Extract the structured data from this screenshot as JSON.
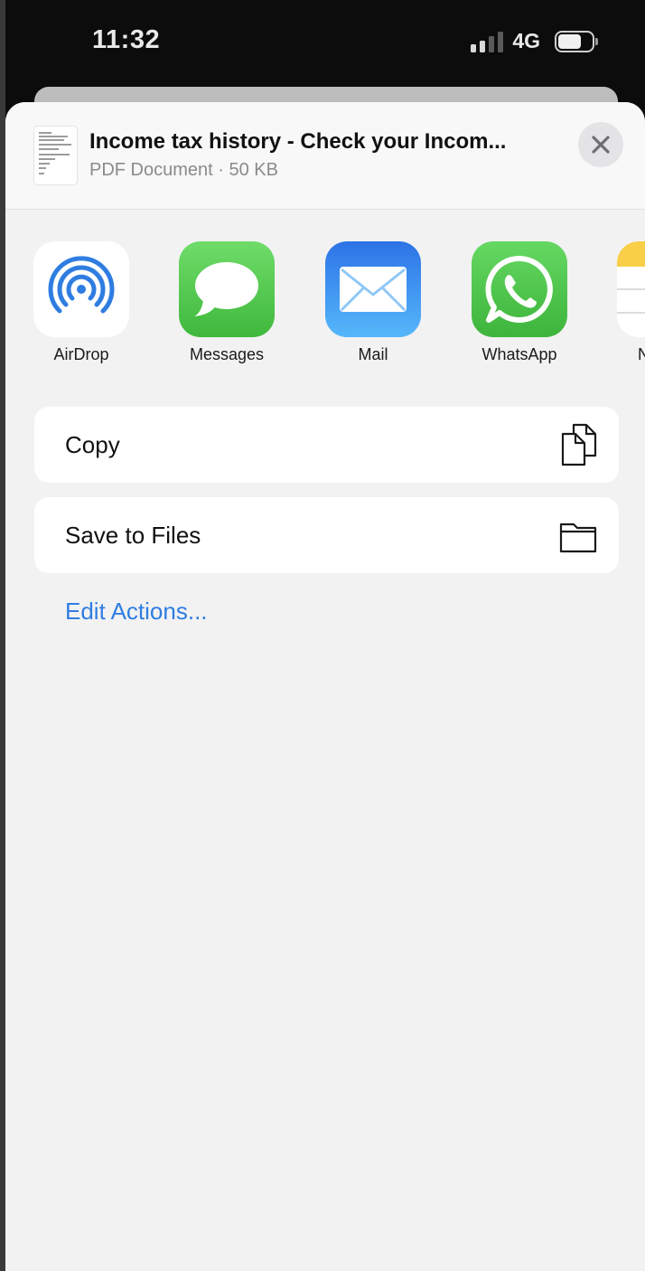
{
  "status_bar": {
    "time": "11:32",
    "network": "4G",
    "signal_bars_active": 2,
    "signal_bars_total": 4,
    "battery_level": 0.6
  },
  "share_sheet": {
    "document": {
      "title": "Income tax history - Check your Incom...",
      "subtitle": "PDF Document · 50 KB",
      "icon": "pdf-thumbnail"
    },
    "close_icon": "close-icon",
    "apps": [
      {
        "label": "AirDrop",
        "icon": "airdrop-icon"
      },
      {
        "label": "Messages",
        "icon": "messages-icon"
      },
      {
        "label": "Mail",
        "icon": "mail-icon"
      },
      {
        "label": "WhatsApp",
        "icon": "whatsapp-icon"
      },
      {
        "label": "N",
        "icon": "notes-icon"
      }
    ],
    "actions": [
      {
        "label": "Copy",
        "icon": "copy-icon"
      },
      {
        "label": "Save to Files",
        "icon": "folder-icon"
      }
    ],
    "edit_actions_label": "Edit Actions..."
  },
  "colors": {
    "accent_blue": "#2f7de1",
    "sheet_background": "#f2f2f3",
    "airdrop_blue": "#2f7de1",
    "messages_green": "#5ecb5a",
    "mail_blue": "#2f86f2",
    "whatsapp_green": "#53c757"
  }
}
